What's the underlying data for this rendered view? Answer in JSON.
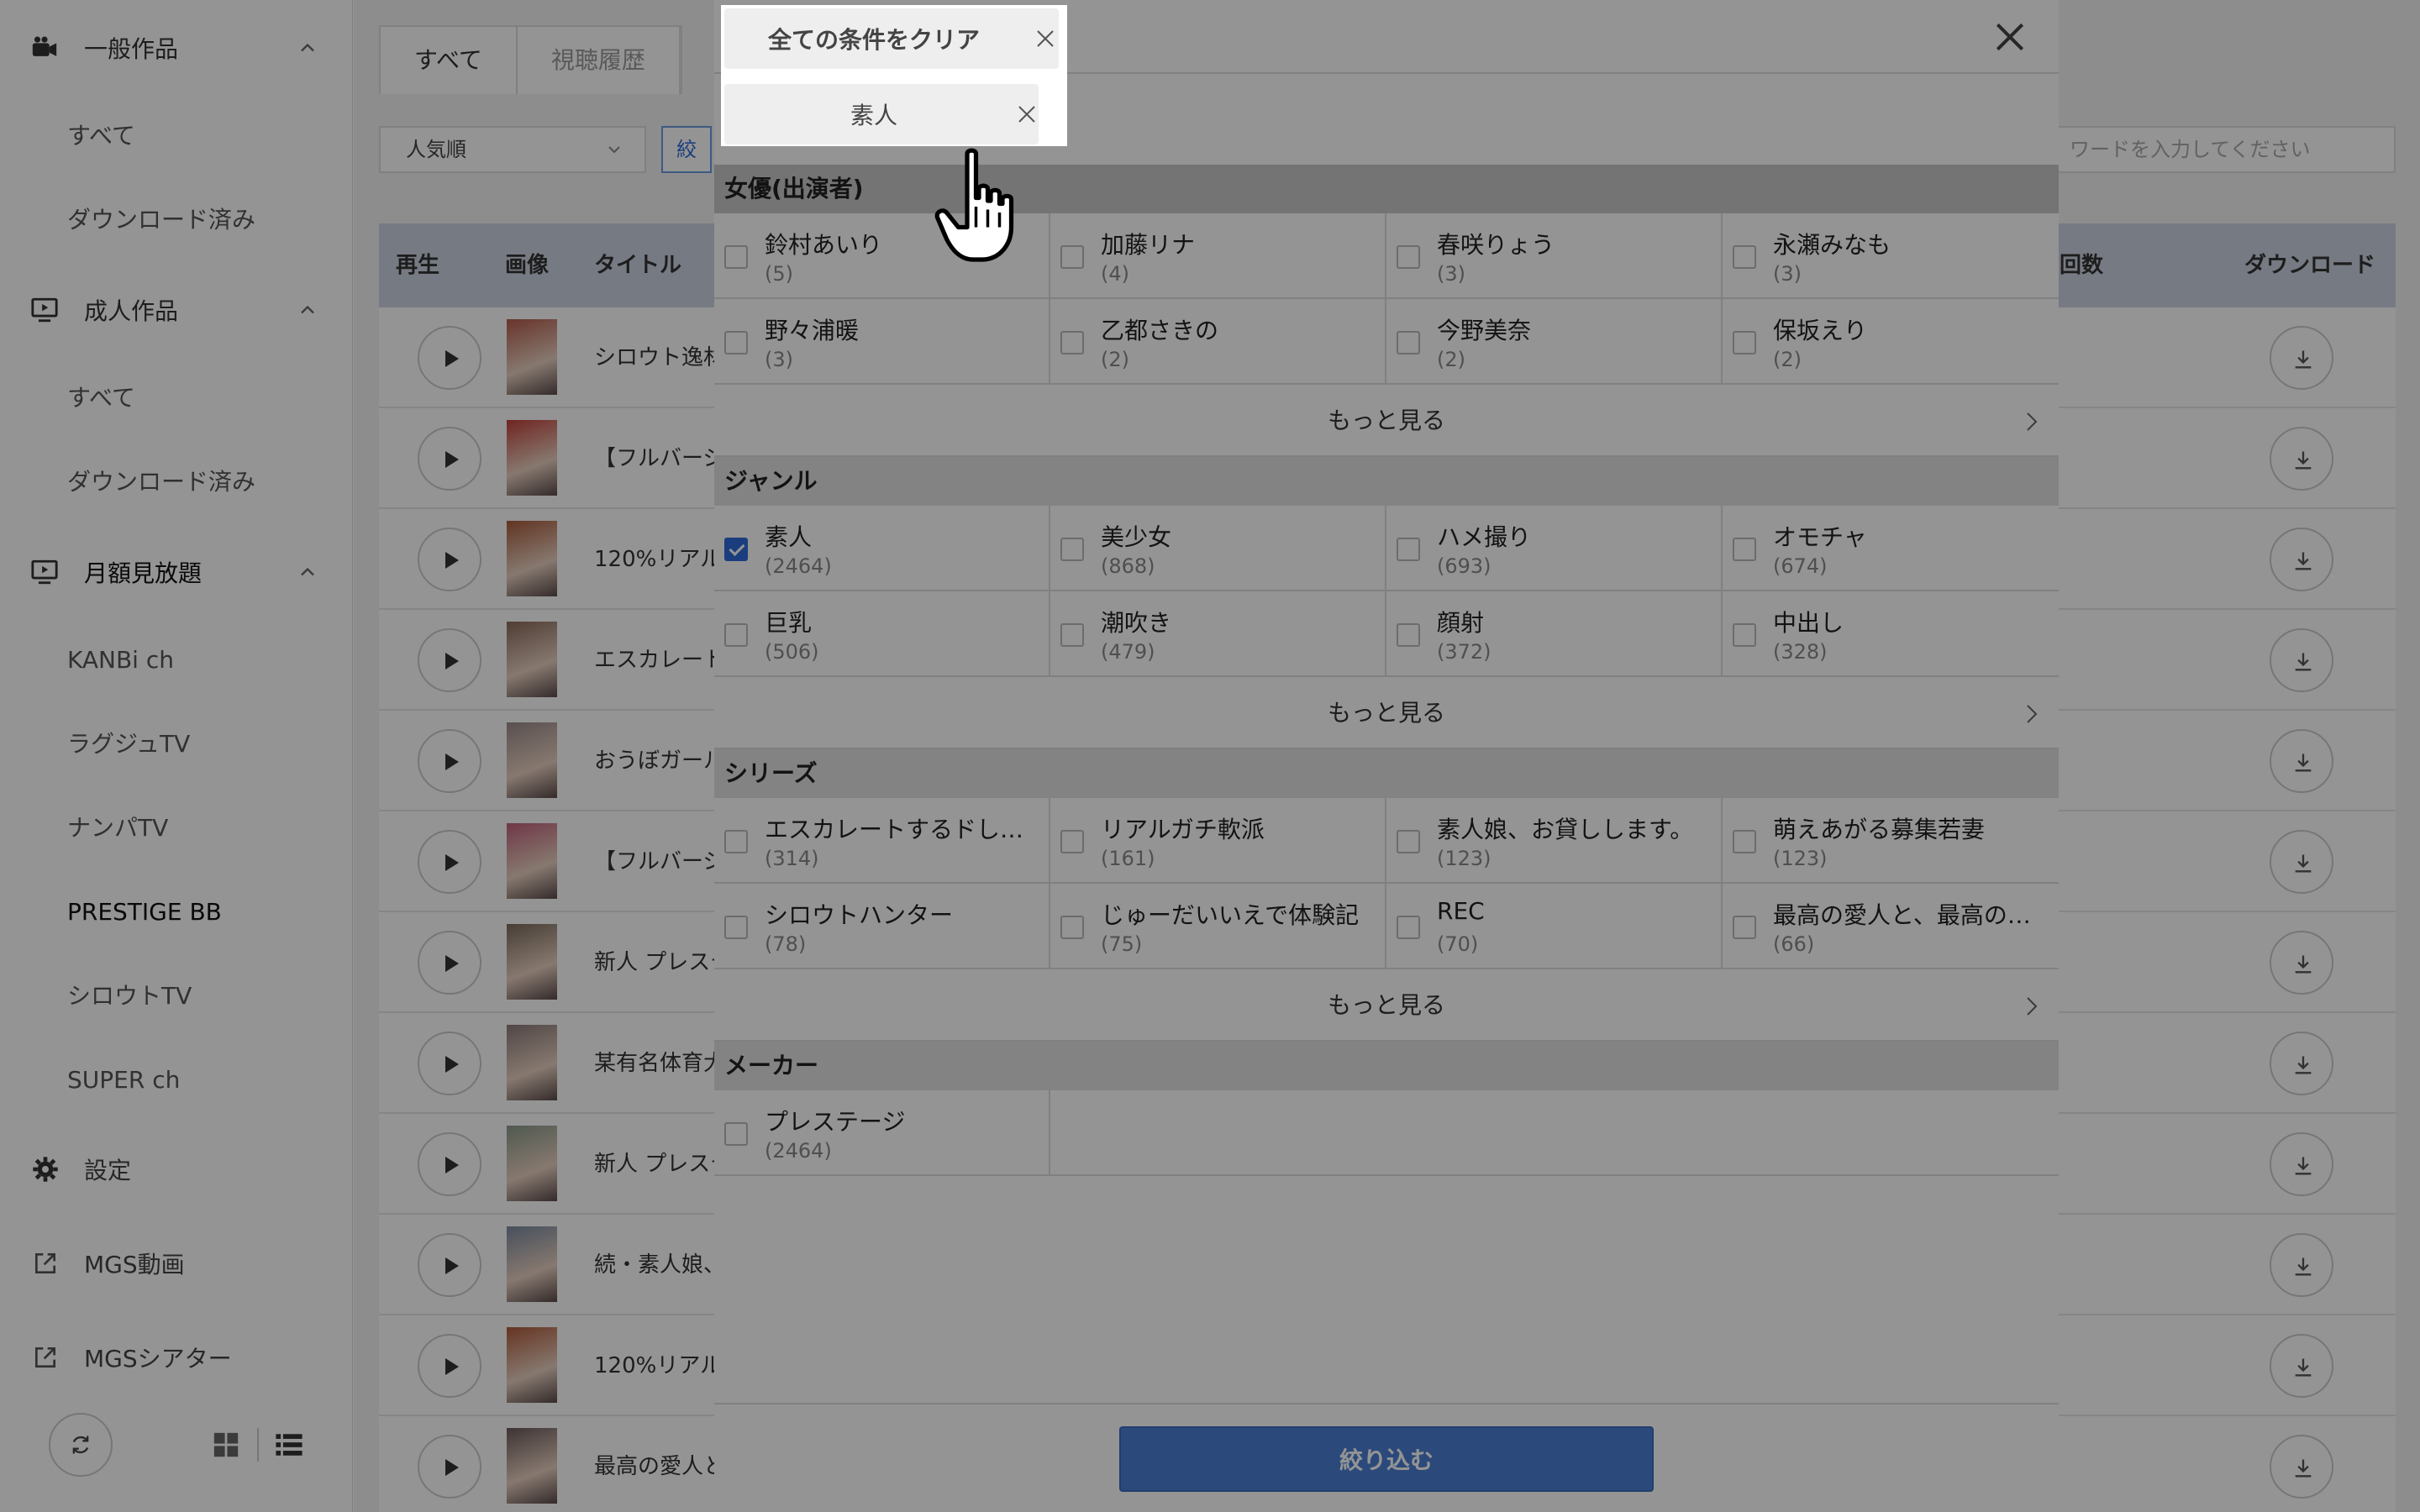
{
  "sidebar": {
    "general": {
      "label": "一般作品",
      "items": [
        "すべて",
        "ダウンロード済み"
      ]
    },
    "adult": {
      "label": "成人作品",
      "items": [
        "すべて",
        "ダウンロード済み"
      ]
    },
    "monthly": {
      "label": "月額見放題",
      "items": [
        "KANBi ch",
        "ラグジュTV",
        "ナンパTV",
        "PRESTIGE BB",
        "シロウトTV",
        "SUPER ch"
      ]
    },
    "settings": "設定",
    "links": [
      "MGS動画",
      "MGSシアター"
    ]
  },
  "main": {
    "tabs": [
      "すべて",
      "視聴履歴"
    ],
    "sort": "人気順",
    "filter_label": "絞",
    "search_placeholder": "ワードを入力してください。",
    "columns": [
      "再生",
      "画像",
      "タイトル",
      "回数",
      "ダウンロード"
    ],
    "rows": [
      "シロウト逸材",
      "【フルバージ",
      "120%リアル",
      "エスカレート",
      "おうぼガール",
      "【フルバージ",
      "新人 プレステ",
      "某有名体育大",
      "新人 プレステ",
      "続・素人娘、",
      "120%リアル",
      "最高の愛人と"
    ]
  },
  "modal": {
    "clear_all": "全ての条件をクリア",
    "active_tag": "素人",
    "more_label": "もっと見る",
    "apply_label": "絞り込む",
    "actresses": {
      "title": "女優(出演者)",
      "items": [
        {
          "name": "鈴村あいり",
          "count": "(5)"
        },
        {
          "name": "加藤リナ",
          "count": "(4)"
        },
        {
          "name": "春咲りょう",
          "count": "(3)"
        },
        {
          "name": "永瀬みなも",
          "count": "(3)"
        },
        {
          "name": "野々浦暖",
          "count": "(3)"
        },
        {
          "name": "乙都さきの",
          "count": "(2)"
        },
        {
          "name": "今野美奈",
          "count": "(2)"
        },
        {
          "name": "保坂えり",
          "count": "(2)"
        }
      ]
    },
    "genres": {
      "title": "ジャンル",
      "items": [
        {
          "name": "素人",
          "count": "(2464)"
        },
        {
          "name": "美少女",
          "count": "(868)"
        },
        {
          "name": "ハメ撮り",
          "count": "(693)"
        },
        {
          "name": "オモチャ",
          "count": "(674)"
        },
        {
          "name": "巨乳",
          "count": "(506)"
        },
        {
          "name": "潮吹き",
          "count": "(479)"
        },
        {
          "name": "顔射",
          "count": "(372)"
        },
        {
          "name": "中出し",
          "count": "(328)"
        }
      ]
    },
    "series": {
      "title": "シリーズ",
      "items": [
        {
          "name": "エスカレートするドし…",
          "count": "(314)"
        },
        {
          "name": "リアルガチ軟派",
          "count": "(161)"
        },
        {
          "name": "素人娘、お貸しします。",
          "count": "(123)"
        },
        {
          "name": "萌えあがる募集若妻",
          "count": "(123)"
        },
        {
          "name": "シロウトハンター",
          "count": "(78)"
        },
        {
          "name": "じゅーだいいえで体験記",
          "count": "(75)"
        },
        {
          "name": "REC",
          "count": "(70)"
        },
        {
          "name": "最高の愛人と、最高の…",
          "count": "(66)"
        }
      ]
    },
    "makers": {
      "title": "メーカー",
      "items": [
        {
          "name": "プレステージ",
          "count": "(2464)"
        }
      ]
    }
  },
  "colors": {
    "accent": "#2d6ad8",
    "apply_button": "#4a7fd4",
    "overlay": "rgba(0,0,0,0.42)"
  },
  "icons": [
    "camera-icon",
    "monitor-icon",
    "chevron-up-icon",
    "gear-icon",
    "external-link-icon",
    "refresh-icon",
    "grid-view-icon",
    "list-view-icon",
    "close-icon",
    "chevron-right-icon",
    "download-icon",
    "play-icon",
    "pointing-hand-cursor-icon"
  ]
}
